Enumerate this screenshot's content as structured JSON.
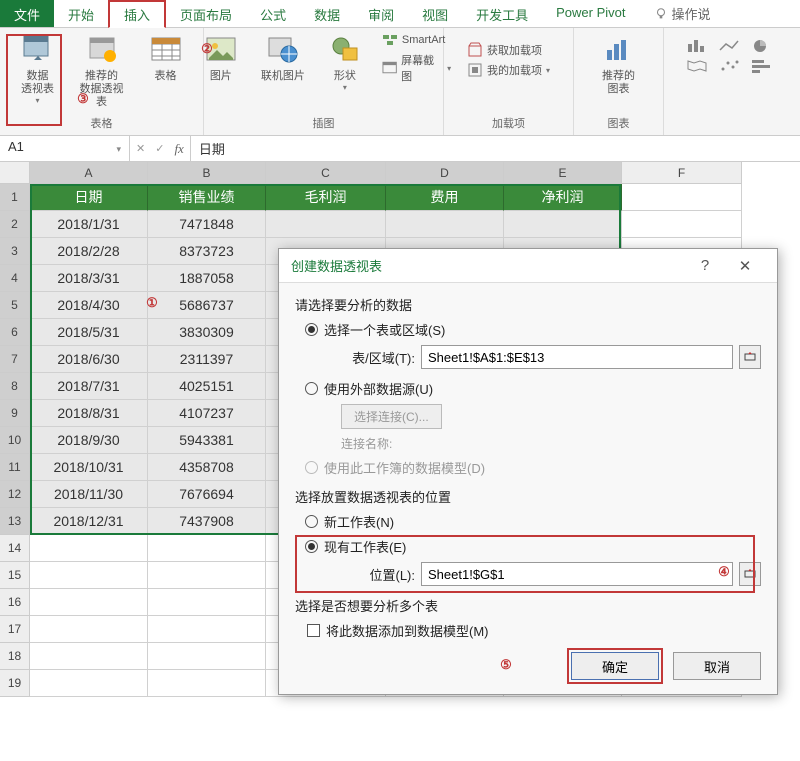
{
  "tabs": {
    "file": "文件",
    "home": "开始",
    "insert": "插入",
    "layout": "页面布局",
    "formula": "公式",
    "data": "数据",
    "review": "审阅",
    "view": "视图",
    "dev": "开发工具",
    "power": "Power Pivot",
    "tell": "操作说"
  },
  "ribbon": {
    "pivot": "数据\n透视表",
    "rec_pivot": "推荐的\n数据透视表",
    "tables_group": "表格",
    "table": "表格",
    "picture": "图片",
    "online_pic": "联机图片",
    "shapes": "形状",
    "smartart": "SmartArt",
    "screenshot": "屏幕截图",
    "illus_group": "插图",
    "get_addin": "获取加载项",
    "my_addin": "我的加载项",
    "addin_group": "加载项",
    "rec_chart": "推荐的\n图表",
    "chart_group": "图表"
  },
  "namebox": "A1",
  "formula_val": "日期",
  "cols": [
    "A",
    "B",
    "C",
    "D",
    "E",
    "F"
  ],
  "headers": [
    "日期",
    "销售业绩",
    "毛利润",
    "费用",
    "净利润"
  ],
  "rows": [
    {
      "date": "2018/1/31",
      "val": "7471848"
    },
    {
      "date": "2018/2/28",
      "val": "8373723"
    },
    {
      "date": "2018/3/31",
      "val": "1887058"
    },
    {
      "date": "2018/4/30",
      "val": "5686737"
    },
    {
      "date": "2018/5/31",
      "val": "3830309"
    },
    {
      "date": "2018/6/30",
      "val": "2311397"
    },
    {
      "date": "2018/7/31",
      "val": "4025151"
    },
    {
      "date": "2018/8/31",
      "val": "4107237"
    },
    {
      "date": "2018/9/30",
      "val": "5943381"
    },
    {
      "date": "2018/10/31",
      "val": "4358708"
    },
    {
      "date": "2018/11/30",
      "val": "7676694"
    },
    {
      "date": "2018/12/31",
      "val": "7437908"
    }
  ],
  "dialog": {
    "title": "创建数据透视表",
    "q": "?",
    "x": "✕",
    "sec1": "请选择要分析的数据",
    "opt_range": "选择一个表或区域(S)",
    "range_lbl": "表/区域(T):",
    "range_val": "Sheet1!$A$1:$E$13",
    "opt_ext": "使用外部数据源(U)",
    "conn_btn": "选择连接(C)...",
    "conn_name": "连接名称:",
    "opt_dm": "使用此工作簿的数据模型(D)",
    "sec2": "选择放置数据透视表的位置",
    "opt_new": "新工作表(N)",
    "opt_exist": "现有工作表(E)",
    "loc_lbl": "位置(L):",
    "loc_val": "Sheet1!$G$1",
    "sec3": "选择是否想要分析多个表",
    "chk_dm": "将此数据添加到数据模型(M)",
    "ok": "确定",
    "cancel": "取消"
  },
  "callouts": {
    "c1": "①",
    "c2": "②",
    "c3": "③",
    "c4": "④",
    "c5": "⑤"
  }
}
